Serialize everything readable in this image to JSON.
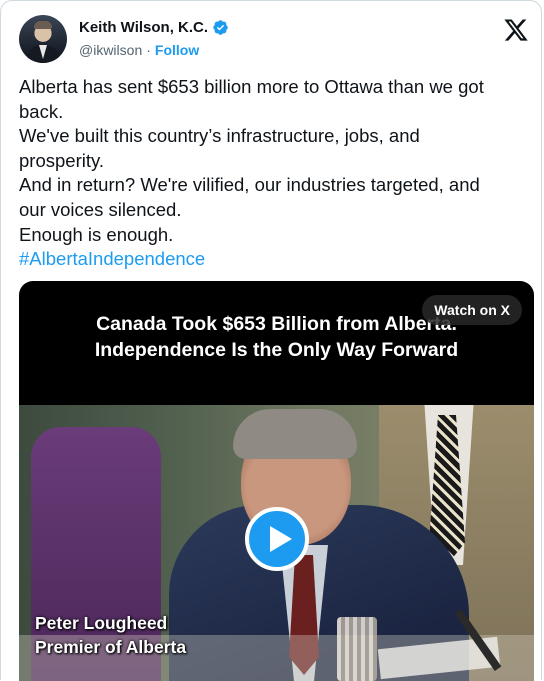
{
  "author": {
    "name": "Keith Wilson, K.C.",
    "handle": "@ikwilson",
    "separator": "·",
    "follow_label": "Follow",
    "verified_icon": "verified-badge-icon",
    "verified_color": "#1d9bf0"
  },
  "platform_icon": "x-logo-icon",
  "tweet": {
    "lines": [
      "Alberta has sent $653 billion more to Ottawa than we got",
      "back.",
      "We've built this country’s infrastructure, jobs, and",
      "prosperity.",
      "And in return? We're vilified, our industries targeted, and",
      "our voices silenced.",
      "Enough is enough."
    ],
    "hashtag": "#AlbertaIndependence"
  },
  "media": {
    "watch_label": "Watch on X",
    "title_line1": "Canada Took $653 Billion from Alberta.",
    "title_line2": "Independence Is the Only Way Forward",
    "caption_line1": "Peter Lougheed",
    "caption_line2": "Premier of Alberta",
    "play_icon": "play-icon"
  },
  "colors": {
    "accent": "#1d9bf0",
    "text": "#0f1419",
    "secondary": "#536471"
  }
}
